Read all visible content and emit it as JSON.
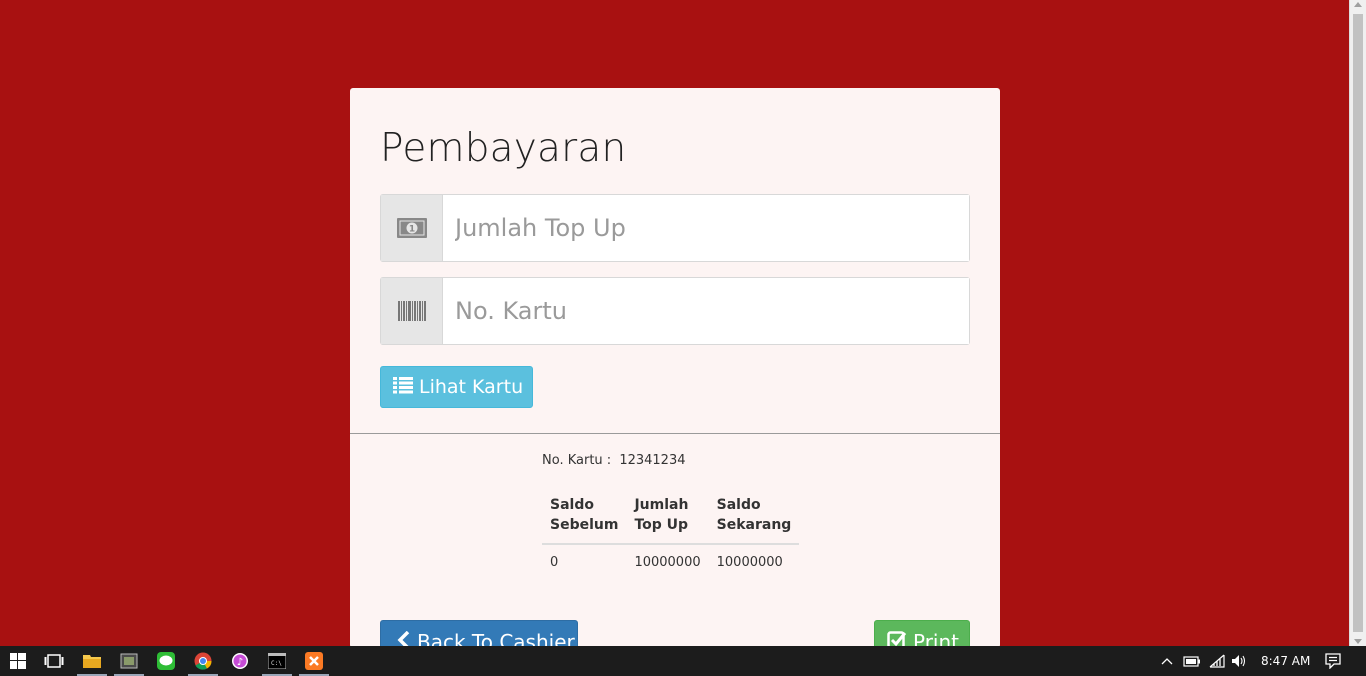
{
  "form": {
    "title": "Pembayaran",
    "amount_placeholder": "Jumlah Top Up",
    "card_placeholder": "No. Kartu",
    "view_card_label": "Lihat Kartu"
  },
  "result": {
    "card_label": "No. Kartu :",
    "card_number": "12341234",
    "headers": [
      "Saldo Sebelum",
      "Jumlah Top Up",
      "Saldo Sekarang"
    ],
    "row": [
      "0",
      "10000000",
      "10000000"
    ]
  },
  "actions": {
    "back_label": "Back To Cashier",
    "print_label": "Print"
  },
  "taskbar": {
    "clock": "8:47 AM",
    "apps": [
      "start-icon",
      "task-view-icon",
      "file-explorer-icon",
      "app-icon",
      "line-icon",
      "chrome-icon",
      "itunes-icon",
      "cmd-icon",
      "xampp-icon"
    ]
  },
  "colors": {
    "background": "#a81111",
    "card": "#fdf4f3",
    "info_button": "#5bc0de",
    "primary_button": "#337ab7",
    "success_button": "#5cb85c"
  }
}
